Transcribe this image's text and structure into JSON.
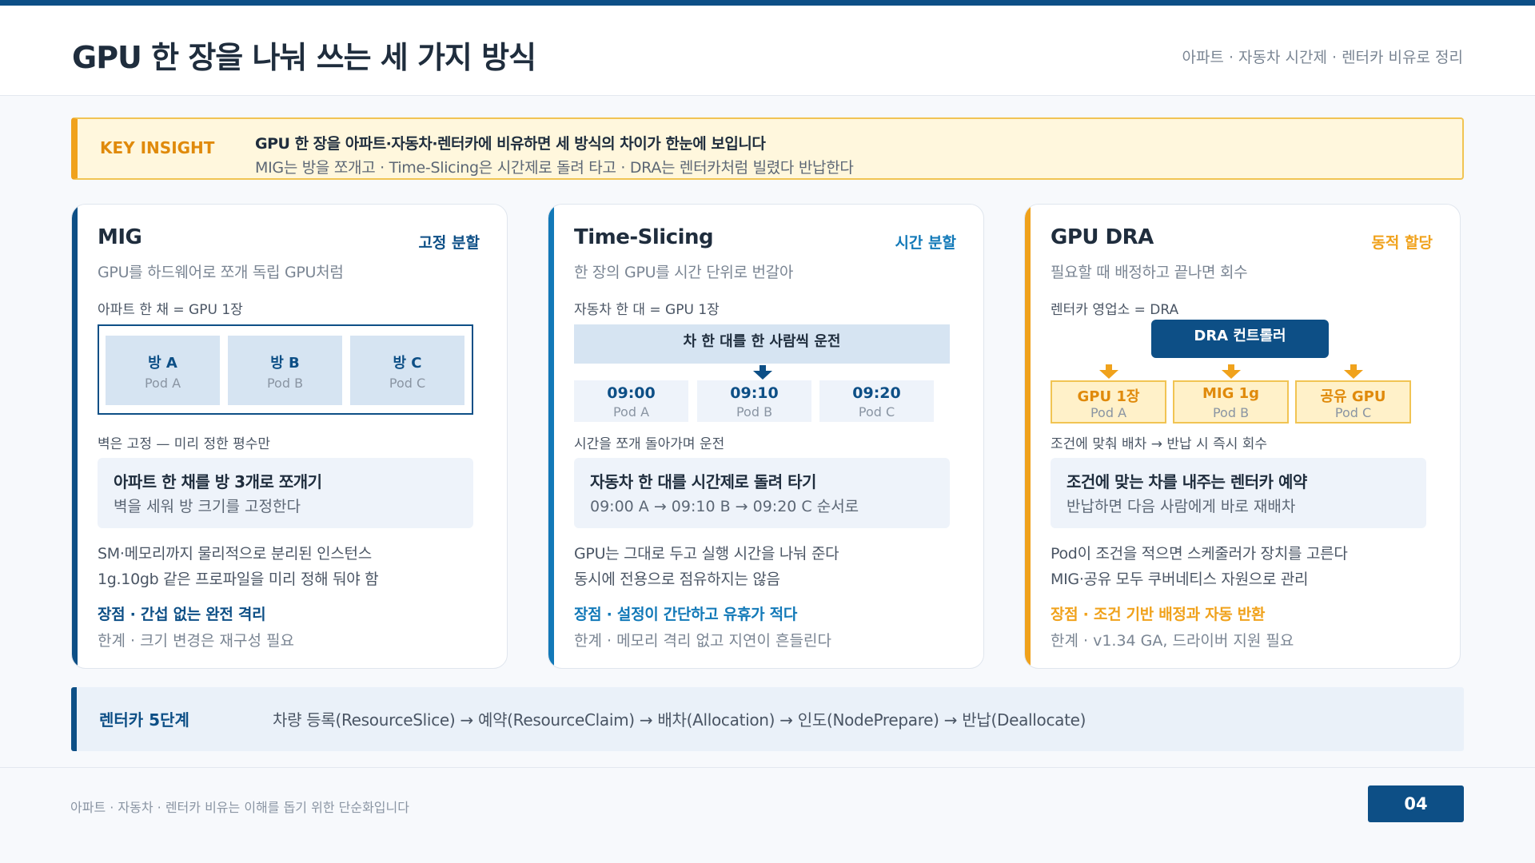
{
  "header": {
    "title": "GPU 한 장을 나눠 쓰는 세 가지 방식",
    "subtitle": "아파트 · 자동차 시간제 · 렌터카 비유로 정리"
  },
  "insight": {
    "tag": "KEY INSIGHT",
    "headline": "GPU 한 장을 아파트·자동차·렌터카에 비유하면 세 방식의 차이가 한눈에 보입니다",
    "body": "MIG는 방을 쪼개고 · Time-Slicing은 시간제로 돌려 타고 · DRA는 렌터카처럼 빌렸다 반납한다"
  },
  "colors": {
    "navy": "#0d4f86",
    "teal": "#1279b8",
    "orange": "#f0a21c"
  },
  "cards": [
    {
      "title": "MIG",
      "tag": "고정 분할",
      "desc": "GPU를 하드웨어로 쪼개 독립 GPU처럼",
      "analogy": "아파트 한 채 = GPU 1장",
      "rooms": [
        {
          "name": "방 A",
          "pod": "Pod A"
        },
        {
          "name": "방 B",
          "pod": "Pod B"
        },
        {
          "name": "방 C",
          "pod": "Pod C"
        }
      ],
      "caption": "벽은 고정 — 미리 정한 평수만",
      "callout_title": "아파트 한 채를 방 3개로 쪼개기",
      "callout_body": "벽을 세워 방 크기를 고정한다",
      "detail1": "SM·메모리까지 물리적으로 분리된 인스턴스",
      "detail2": "1g.10gb 같은 프로파일을 미리 정해 둬야 함",
      "pros": "장점 · 간섭 없는 완전 격리",
      "cons": "한계 · 크기 변경은 재구성 필요"
    },
    {
      "title": "Time-Slicing",
      "tag": "시간 분할",
      "desc": "한 장의 GPU를 시간 단위로 번갈아",
      "analogy": "자동차 한 대 = GPU 1장",
      "banner": "차 한 대를 한 사람씩 운전",
      "slots": [
        {
          "time": "09:00",
          "pod": "Pod A"
        },
        {
          "time": "09:10",
          "pod": "Pod B"
        },
        {
          "time": "09:20",
          "pod": "Pod C"
        }
      ],
      "caption": "시간을 쪼개 돌아가며 운전",
      "callout_title": "자동차 한 대를 시간제로 돌려 타기",
      "callout_body": "09:00 A → 09:10 B → 09:20 C 순서로",
      "detail1": "GPU는 그대로 두고 실행 시간을 나눠 준다",
      "detail2": "동시에 전용으로 점유하지는 않음",
      "pros": "장점 · 설정이 간단하고 유휴가 적다",
      "cons": "한계 · 메모리 격리 없고 지연이 흔들린다"
    },
    {
      "title": "GPU DRA",
      "tag": "동적 할당",
      "desc": "필요할 때 배정하고 끝나면 회수",
      "analogy": "렌터카 영업소 = DRA",
      "controller": "DRA 컨트롤러",
      "resources": [
        {
          "name": "GPU 1장",
          "pod": "Pod A"
        },
        {
          "name": "MIG 1g",
          "pod": "Pod B"
        },
        {
          "name": "공유 GPU",
          "pod": "Pod C"
        }
      ],
      "caption": "조건에 맞춰 배차 → 반납 시 즉시 회수",
      "callout_title": "조건에 맞는 차를 내주는 렌터카 예약",
      "callout_body": "반납하면 다음 사람에게 바로 재배차",
      "detail1": "Pod이 조건을 적으면 스케줄러가 장치를 고른다",
      "detail2": "MIG·공유 모두 쿠버네티스 자원으로 관리",
      "pros": "장점 · 조건 기반 배정과 자동 반환",
      "cons": "한계 · v1.34 GA, 드라이버 지원 필요"
    }
  ],
  "steps": {
    "label": "렌터카 5단계",
    "text": "차량 등록(ResourceSlice) → 예약(ResourceClaim) → 배차(Allocation) → 인도(NodePrepare) → 반납(Deallocate)"
  },
  "footer": {
    "note": "아파트 · 자동차 · 렌터카 비유는 이해를 돕기 위한 단순화입니다",
    "page_number": "04"
  }
}
